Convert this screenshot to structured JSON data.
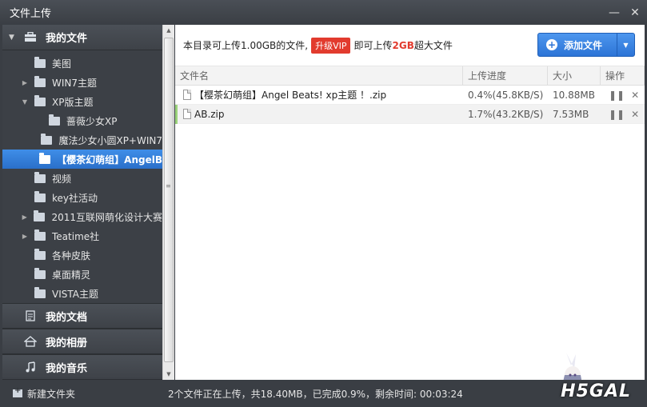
{
  "window": {
    "title": "文件上传"
  },
  "sidebar": {
    "my_files": "我的文件",
    "tree": [
      {
        "label": "美图",
        "expandable": false,
        "level": 1
      },
      {
        "label": "WIN7主题",
        "expandable": true,
        "level": 1
      },
      {
        "label": "XP版主题",
        "expandable": true,
        "expanded": true,
        "level": 1
      },
      {
        "label": "蔷薇少女XP",
        "expandable": false,
        "level": 2
      },
      {
        "label": "魔法少女小圆XP+WIN7",
        "expandable": false,
        "level": 2
      },
      {
        "label": "【樱茶幻萌组】AngelB",
        "expandable": false,
        "level": 2,
        "selected": true
      },
      {
        "label": "视频",
        "expandable": false,
        "level": 1
      },
      {
        "label": "key社活动",
        "expandable": false,
        "level": 1
      },
      {
        "label": "2011互联网萌化设计大赛",
        "expandable": true,
        "level": 1
      },
      {
        "label": "Teatime社",
        "expandable": true,
        "level": 1
      },
      {
        "label": "各种皮肤",
        "expandable": false,
        "level": 1
      },
      {
        "label": "桌面精灵",
        "expandable": false,
        "level": 1
      },
      {
        "label": "VISTA主题",
        "expandable": false,
        "level": 1
      }
    ],
    "my_docs": "我的文档",
    "my_albums": "我的相册",
    "my_music": "我的音乐"
  },
  "notice": {
    "prefix": "本目录可上传1.00GB的文件,",
    "vip": "升级VIP",
    "middle": "即可上传",
    "big": "2GB",
    "suffix": "超大文件"
  },
  "add_button": {
    "label": "添加文件"
  },
  "table": {
    "headers": [
      "文件名",
      "上传进度",
      "大小",
      "操作"
    ],
    "rows": [
      {
        "name": "【樱茶幻萌组】Angel Beats! xp主题 ！.zip",
        "progress": "0.4%(45.8KB/S)",
        "size": "10.88MB"
      },
      {
        "name": "AB.zip",
        "progress": "1.7%(43.2KB/S)",
        "size": "7.53MB"
      }
    ]
  },
  "status": {
    "new_folder": "新建文件夹",
    "summary": "2个文件正在上传，共18.40MB，已完成0.9%，剩余时间: 00:03:24"
  },
  "logo_text": "H5GAL"
}
